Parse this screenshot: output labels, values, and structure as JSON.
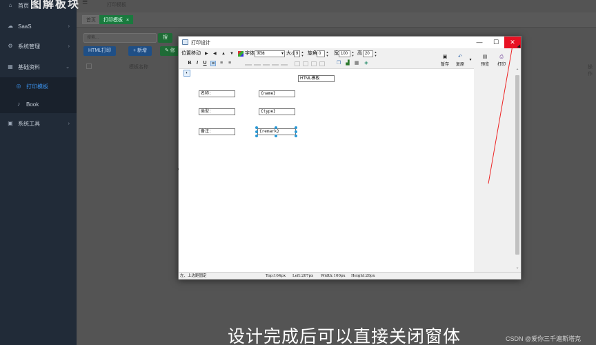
{
  "sidebar": {
    "items": [
      {
        "label": "首页",
        "icon": "home-icon",
        "glyph": "⌂"
      },
      {
        "label": "SaaS",
        "icon": "cloud-icon",
        "glyph": "☁",
        "arrow": "›"
      },
      {
        "label": "系统管理",
        "icon": "gear-icon",
        "glyph": "⚙",
        "arrow": "›"
      },
      {
        "label": "基础资料",
        "icon": "grid-icon",
        "glyph": "▦",
        "arrow": "⌄"
      },
      {
        "label": "打印模板",
        "icon": "print-icon",
        "glyph": "◎"
      },
      {
        "label": "Book",
        "icon": "book-icon",
        "glyph": "♪"
      },
      {
        "label": "系统工具",
        "icon": "briefcase-icon",
        "glyph": "▣",
        "arrow": "›"
      }
    ]
  },
  "header": {
    "menu_glyph": "☰",
    "tabs": [
      "首页",
      "打印模板"
    ],
    "active_close": "×",
    "breadcrumb": "打印模板"
  },
  "toolbar_bg": {
    "search_placeholder": "搜索...",
    "search_btn": "搜",
    "html_print": "HTML打印",
    "add": "+ 新增",
    "edit": "✎ 修",
    "col_name": "模板名称",
    "col_right": "操作"
  },
  "dialog": {
    "title": "打印设计",
    "minimize": "—",
    "maximize": "☐",
    "close": "✕",
    "toolbar1": {
      "position_label": "位置移动",
      "arrows": [
        "▶",
        "◀",
        "▲",
        "▼"
      ],
      "font_label": "字体",
      "font_value": "宋体",
      "size_label": "大小",
      "size_value": "9",
      "angle_label": "旋角",
      "angle_value": "0",
      "width_label": "宽",
      "width_value": "100",
      "height_label": "高",
      "height_value": "20"
    },
    "toolbar2": {
      "bold": "B",
      "italic": "I",
      "underline": "U"
    },
    "actions": [
      {
        "label": "暂存",
        "glyph": "▣"
      },
      {
        "label": "复原",
        "glyph": "↶"
      },
      {
        "label": "预览",
        "glyph": "▤"
      },
      {
        "label": "打印",
        "glyph": "⎙"
      }
    ],
    "dropdown_glyph": "▾",
    "canvas": {
      "title_field": "HTML模板",
      "labels": [
        "名称：",
        "类型：",
        "备注："
      ],
      "values": [
        "{name}",
        "{type}",
        "{remark}"
      ]
    },
    "scroll_up": "⌃",
    "scroll_down": "⌄",
    "status": {
      "left": "左、上边距固定",
      "top": "Top:164px",
      "left_px": "Left:207px",
      "width": "Width:100px",
      "height": "Height:20px"
    }
  },
  "caption": "设计完成后可以直接关闭窗体",
  "watermark": "CSDN @爱你三千遍斯塔克",
  "top_watermark": "图解板块"
}
